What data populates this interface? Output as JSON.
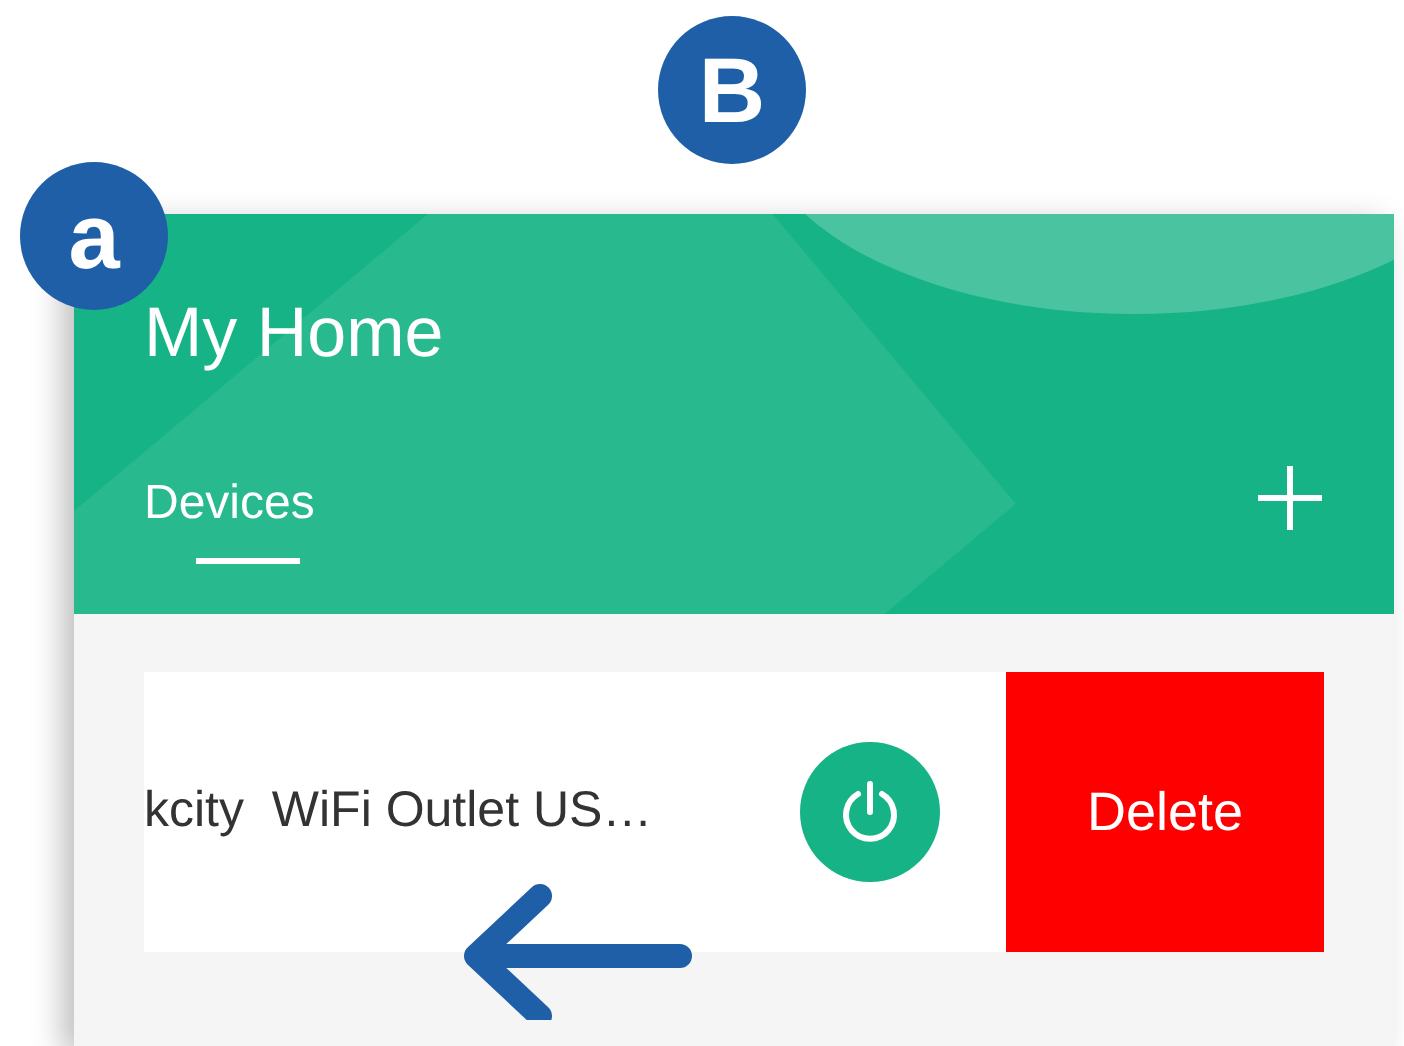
{
  "figure_label": "B",
  "panel_label": "a",
  "header": {
    "title": "My Home",
    "tabs": [
      {
        "label": "Devices",
        "selected": true
      }
    ]
  },
  "devices": [
    {
      "name": "kcity  WiFi Outlet US…",
      "action": "Delete"
    }
  ]
}
